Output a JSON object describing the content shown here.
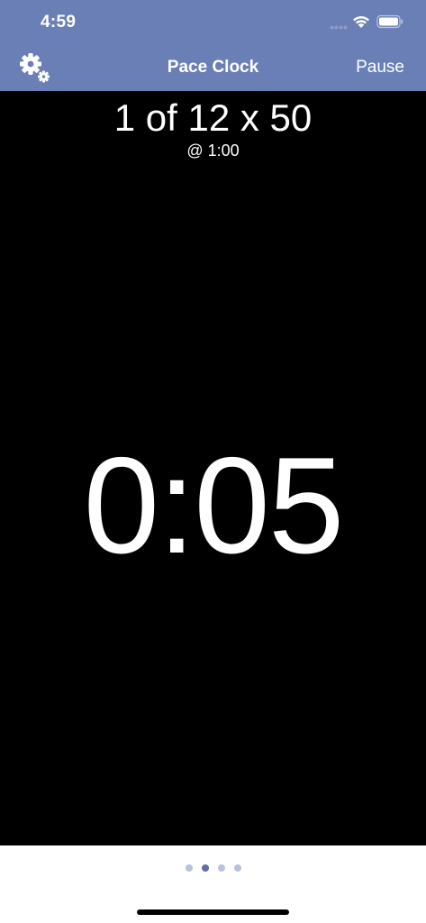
{
  "status_bar": {
    "time": "4:59"
  },
  "nav": {
    "title": "Pace Clock",
    "pause_label": "Pause",
    "settings_icon": "gear-icon"
  },
  "workout": {
    "set_progress": "1 of 12 x 50",
    "interval": "@ 1:00",
    "timer": "0:05"
  },
  "pager": {
    "page_count": 4,
    "active_page": 2
  },
  "colors": {
    "header": "#6a7fb5",
    "background": "#000000",
    "text": "#ffffff",
    "dot_active": "#5c6fa6",
    "dot_inactive": "#b9c2da"
  }
}
